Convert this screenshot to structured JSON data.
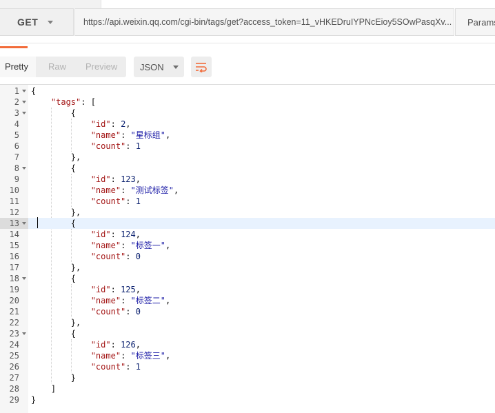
{
  "request": {
    "method": "GET",
    "url": "https://api.weixin.qq.com/cgi-bin/tags/get?access_token=11_vHKEDruIYPNcEioy5SOwPasqXv...",
    "params_label": "Params"
  },
  "response_toolbar": {
    "views": [
      "Pretty",
      "Raw",
      "Preview"
    ],
    "format": "JSON"
  },
  "editor": {
    "active_line": 13,
    "lines": [
      "{",
      "    \"tags\": [",
      "        {",
      "            \"id\": 2,",
      "            \"name\": \"星标组\",",
      "            \"count\": 1",
      "        },",
      "        {",
      "            \"id\": 123,",
      "            \"name\": \"测试标签\",",
      "            \"count\": 1",
      "        },",
      "        {",
      "            \"id\": 124,",
      "            \"name\": \"标签一\",",
      "            \"count\": 0",
      "        },",
      "        {",
      "            \"id\": 125,",
      "            \"name\": \"标签二\",",
      "            \"count\": 0",
      "        },",
      "        {",
      "            \"id\": 126,",
      "            \"name\": \"标签三\",",
      "            \"count\": 1",
      "        }",
      "    ]",
      "}"
    ],
    "foldable_lines": [
      1,
      2,
      3,
      8,
      13,
      18,
      23
    ]
  },
  "colors": {
    "accent": "#f26b3a",
    "json_key": "#a31515",
    "json_string": "#1a1aa6",
    "json_number": "#0b216f",
    "active_line_bg": "#e8f2fe"
  },
  "icons": {
    "method_dropdown": "chevron-down-icon",
    "format_dropdown": "chevron-down-icon",
    "wrap": "text-wrap-icon",
    "fold": "fold-arrow-icon"
  }
}
